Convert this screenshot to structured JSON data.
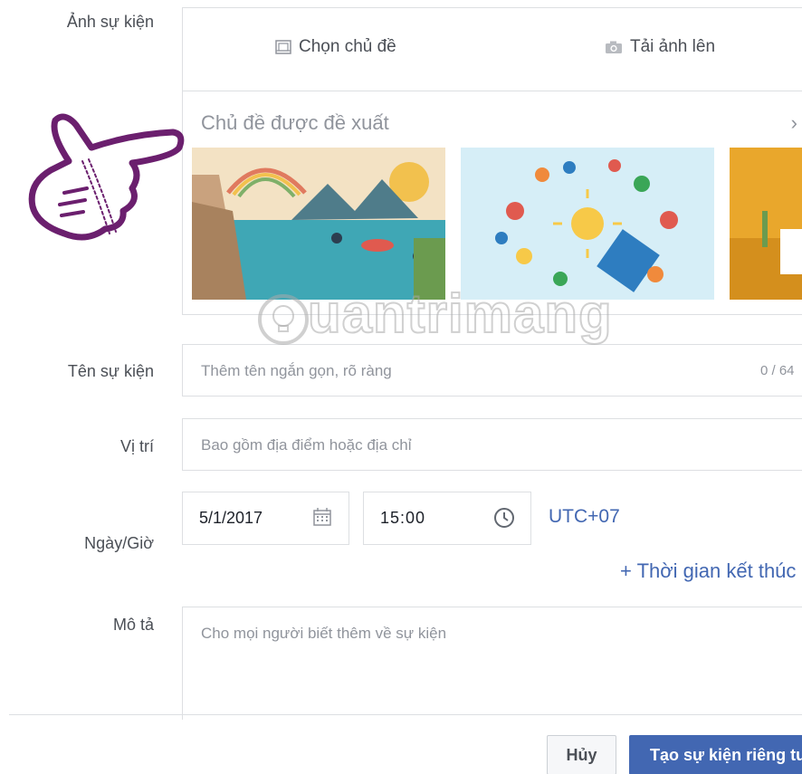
{
  "labels": {
    "event_photo": "Ảnh sự kiện",
    "event_name": "Tên sự kiện",
    "location": "Vị trí",
    "datetime": "Ngày/Giờ",
    "description": "Mô tả"
  },
  "photo": {
    "tab_theme": "Chọn chủ đề",
    "tab_upload": "Tải ảnh lên",
    "suggested_title": "Chủ đề được đề xuất",
    "themes": [
      "lake-illustration",
      "summer-beach-items",
      "desert-cactus"
    ]
  },
  "event_name": {
    "placeholder": "Thêm tên ngắn gọn, rõ ràng",
    "counter": "0 / 64"
  },
  "location": {
    "placeholder": "Bao gồm địa điểm hoặc địa chỉ"
  },
  "datetime": {
    "date": "5/1/2017",
    "time": "15:00",
    "timezone": "UTC+07",
    "add_end_time": "+ Thời gian kết thúc"
  },
  "description": {
    "placeholder": "Cho mọi người biết thêm về sự kiện"
  },
  "buttons": {
    "cancel": "Hủy",
    "create": "Tạo sự kiện riêng tư"
  },
  "watermark": "uantrimang",
  "colors": {
    "link": "#4267b2",
    "primary_button": "#4267b2",
    "border": "#dddfe2",
    "hand_outline": "#6b1f6e"
  }
}
